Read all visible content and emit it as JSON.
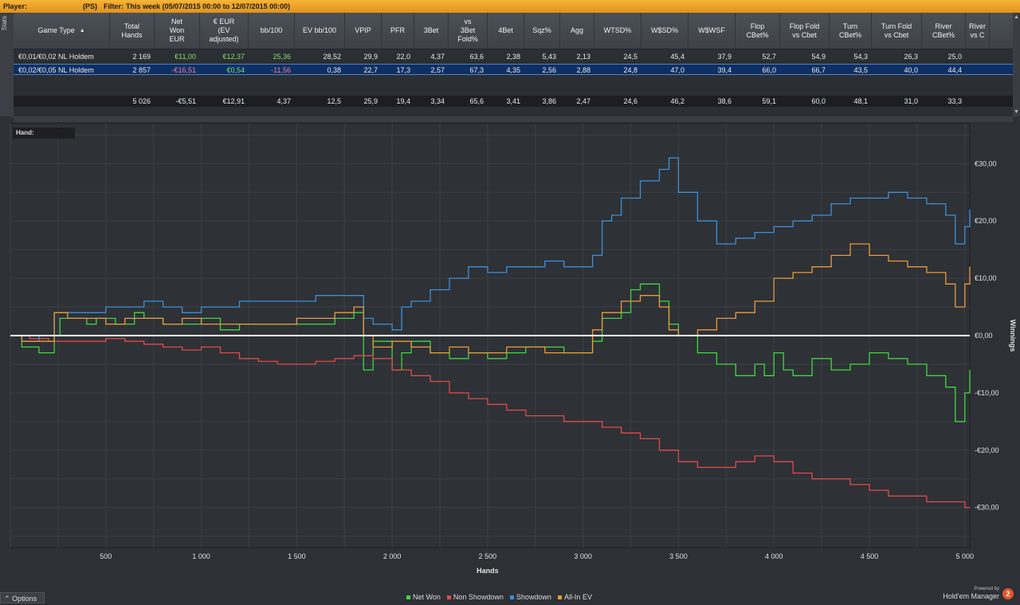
{
  "topbar": {
    "player_label": "Player:",
    "site": "(PS)",
    "filter_label": "Filter:",
    "filter_value": "This week (05/07/2015 00:00 to 12/07/2015 00:00)"
  },
  "stats_tab": "Stats",
  "table": {
    "columns": [
      {
        "label": "Game Type",
        "w": 121
      },
      {
        "label": "Total\nHands",
        "w": 56
      },
      {
        "label": "Net\nWon\nEUR",
        "w": 57
      },
      {
        "label": "€ EUR\n(EV\nadjusted)",
        "w": 61
      },
      {
        "label": "bb/100",
        "w": 58
      },
      {
        "label": "EV bb/100",
        "w": 63
      },
      {
        "label": "VPIP",
        "w": 46
      },
      {
        "label": "PFR",
        "w": 41
      },
      {
        "label": "3Bet",
        "w": 43
      },
      {
        "label": "vs\n3Bet\nFold%",
        "w": 49
      },
      {
        "label": "4Bet",
        "w": 46
      },
      {
        "label": "Sqz%",
        "w": 45
      },
      {
        "label": "Agg",
        "w": 43
      },
      {
        "label": "WTSD%",
        "w": 59
      },
      {
        "label": "W$SD%",
        "w": 59
      },
      {
        "label": "W$WSF",
        "w": 59
      },
      {
        "label": "Flop\nCBet%",
        "w": 56
      },
      {
        "label": "Flop Fold\nvs Cbet",
        "w": 62
      },
      {
        "label": "Turn\nCBet%",
        "w": 53
      },
      {
        "label": "Turn Fold\nvs Cbet",
        "w": 63
      },
      {
        "label": "River\nCBet%",
        "w": 55
      },
      {
        "label": "River\nvs C",
        "w": 30
      }
    ],
    "sort_arrow": "▲",
    "rows": [
      {
        "cells": [
          "€0,01/€0,02 NL Holdem",
          "2 169",
          "€11,00",
          "€12,37",
          "25,36",
          "28,52",
          "29,9",
          "22,0",
          "4,37",
          "63,6",
          "2,38",
          "5,43",
          "2,13",
          "24,5",
          "45,4",
          "37,9",
          "52,7",
          "54,9",
          "54,3",
          "26,3",
          "25,0",
          ""
        ],
        "signs": [
          "",
          "",
          "pos",
          "pos",
          "pos",
          "",
          "",
          "",
          "",
          "",
          "",
          "",
          "",
          "",
          "",
          "",
          "",
          "",
          "",
          "",
          "",
          ""
        ]
      },
      {
        "cells": [
          "€0,02/€0,05 NL Holdem",
          "2 857",
          "-€16,51",
          "€0,54",
          "-11,56",
          "0,38",
          "22,7",
          "17,3",
          "2,57",
          "67,3",
          "4,35",
          "2,56",
          "2,88",
          "24,8",
          "47,0",
          "39,4",
          "66,0",
          "66,7",
          "43,5",
          "40,0",
          "44,4",
          ""
        ],
        "signs": [
          "",
          "",
          "neg",
          "pos",
          "neg",
          "",
          "",
          "",
          "",
          "",
          "",
          "",
          "",
          "",
          "",
          "",
          "",
          "",
          "",
          "",
          "",
          ""
        ]
      }
    ],
    "total": {
      "cells": [
        "",
        "5 026",
        "-€5,51",
        "€12,91",
        "4,37",
        "12,5",
        "25,9",
        "19,4",
        "3,34",
        "65,6",
        "3,41",
        "3,86",
        "2,47",
        "24,6",
        "46,2",
        "38,6",
        "59,1",
        "60,0",
        "48,1",
        "31,0",
        "33,3",
        ""
      ]
    }
  },
  "chart": {
    "hand_label": "Hand:",
    "x_title": "Hands",
    "y_title": "Winnings",
    "x_ticks": [
      "500",
      "1 000",
      "1 500",
      "2 000",
      "2 500",
      "3 000",
      "3 500",
      "4 000",
      "4 500",
      "5 000"
    ],
    "x_tick_values": [
      500,
      1000,
      1500,
      2000,
      2500,
      3000,
      3500,
      4000,
      4500,
      5000
    ],
    "y_ticks": [
      "€30,00",
      "€20,00",
      "€10,00",
      "€0,00",
      "-€10,00",
      "-€20,00",
      "-€30,00"
    ],
    "y_tick_values": [
      30,
      20,
      10,
      0,
      -10,
      -20,
      -30
    ]
  },
  "chart_data": {
    "type": "line",
    "xlabel": "Hands",
    "ylabel": "Winnings",
    "xlim": [
      0,
      5026
    ],
    "ylim": [
      -37,
      37
    ],
    "series": [
      {
        "name": "Net Won",
        "color": "#3fd63f",
        "x": [
          0,
          60,
          150,
          230,
          260,
          300,
          400,
          450,
          550,
          650,
          700,
          800,
          900,
          1000,
          1100,
          1200,
          1300,
          1400,
          1500,
          1600,
          1700,
          1800,
          1850,
          1900,
          2000,
          2050,
          2100,
          2200,
          2300,
          2400,
          2500,
          2600,
          2700,
          2800,
          2900,
          3000,
          3050,
          3100,
          3200,
          3250,
          3300,
          3400,
          3450,
          3500,
          3600,
          3700,
          3800,
          3900,
          3950,
          4000,
          4050,
          4100,
          4200,
          4300,
          4400,
          4500,
          4600,
          4700,
          4800,
          4900,
          4950,
          5000,
          5026
        ],
        "y": [
          0,
          -2,
          -3,
          0,
          3,
          3,
          2,
          3,
          2,
          4,
          3,
          2,
          2,
          3,
          1,
          2,
          2,
          2,
          2,
          2,
          3,
          4,
          -6,
          -1,
          -6,
          -3,
          -1,
          -3,
          -4,
          -3,
          -4,
          -3,
          -2,
          -2,
          -3,
          -3,
          -1,
          3,
          4,
          8,
          9,
          6,
          2,
          0,
          -3,
          -5,
          -7,
          -5,
          -7,
          -3,
          -6,
          -7,
          -4,
          -6,
          -5,
          -3,
          -4,
          -5,
          -7,
          -9,
          -15,
          -10,
          -6
        ]
      },
      {
        "name": "Non Showdown",
        "color": "#e04a4a",
        "x": [
          0,
          100,
          200,
          300,
          400,
          500,
          600,
          700,
          800,
          900,
          1000,
          1100,
          1200,
          1300,
          1400,
          1500,
          1600,
          1700,
          1800,
          1900,
          2000,
          2100,
          2200,
          2300,
          2400,
          2500,
          2600,
          2700,
          2800,
          2900,
          3000,
          3100,
          3200,
          3300,
          3400,
          3500,
          3600,
          3700,
          3800,
          3900,
          4000,
          4100,
          4200,
          4300,
          4400,
          4500,
          4600,
          4700,
          4800,
          4900,
          5000,
          5026
        ],
        "y": [
          0,
          -0.5,
          -1,
          -1,
          -1,
          -0.5,
          -1,
          -1.5,
          -2,
          -2.5,
          -2,
          -3,
          -4,
          -4.5,
          -5,
          -5,
          -4.5,
          -4,
          -3.5,
          -4,
          -6,
          -7,
          -8,
          -10,
          -11,
          -12,
          -13,
          -14,
          -14,
          -15,
          -15,
          -16,
          -17,
          -18,
          -20,
          -22,
          -23,
          -23,
          -22,
          -21,
          -22,
          -24,
          -25,
          -25,
          -26,
          -27,
          -28,
          -28,
          -29,
          -29,
          -30,
          -30
        ]
      },
      {
        "name": "Showdown",
        "color": "#3d8fd6",
        "x": [
          0,
          60,
          150,
          230,
          300,
          400,
          500,
          600,
          700,
          800,
          900,
          1000,
          1100,
          1200,
          1300,
          1400,
          1500,
          1600,
          1700,
          1800,
          1850,
          1900,
          2000,
          2050,
          2100,
          2200,
          2300,
          2400,
          2500,
          2600,
          2700,
          2800,
          2900,
          3000,
          3050,
          3100,
          3150,
          3200,
          3300,
          3400,
          3450,
          3500,
          3600,
          3700,
          3800,
          3900,
          4000,
          4100,
          4200,
          4300,
          4400,
          4500,
          4600,
          4700,
          4800,
          4900,
          4950,
          5000,
          5026
        ],
        "y": [
          0,
          -1,
          0,
          4,
          4,
          4,
          5,
          5,
          6,
          5,
          4,
          5,
          5,
          6,
          6,
          6,
          6,
          7,
          7,
          7,
          3,
          2,
          1,
          5,
          6,
          8,
          10,
          12,
          11,
          12,
          12,
          13,
          12,
          12,
          14,
          20,
          21,
          24,
          27,
          29,
          31,
          25,
          20,
          16,
          17,
          18,
          19,
          20,
          21,
          23,
          24,
          24,
          25,
          24,
          23,
          21,
          16,
          19,
          22
        ]
      },
      {
        "name": "All-In EV",
        "color": "#e89a3c",
        "x": [
          0,
          60,
          150,
          230,
          300,
          400,
          500,
          600,
          700,
          800,
          900,
          1000,
          1100,
          1200,
          1300,
          1400,
          1500,
          1600,
          1700,
          1800,
          1850,
          1900,
          2000,
          2100,
          2200,
          2300,
          2400,
          2500,
          2600,
          2700,
          2800,
          2900,
          3000,
          3050,
          3100,
          3200,
          3300,
          3400,
          3450,
          3500,
          3600,
          3700,
          3800,
          3900,
          4000,
          4100,
          4200,
          4300,
          4400,
          4500,
          4600,
          4700,
          4800,
          4900,
          4950,
          5000,
          5026
        ],
        "y": [
          0,
          -1,
          -1,
          4,
          3,
          3,
          2,
          3,
          3,
          2,
          3,
          2,
          2,
          2,
          2,
          2,
          3,
          3,
          4,
          5,
          0,
          -2,
          -1,
          -2,
          -3,
          -2,
          -3,
          -3,
          -2,
          -2,
          -3,
          -3,
          -3,
          1,
          4,
          6,
          7,
          5,
          1,
          0,
          1,
          3,
          4,
          6,
          10,
          11,
          12,
          14,
          16,
          14,
          13,
          12,
          11,
          9,
          5,
          9,
          12
        ]
      }
    ]
  },
  "bottom": {
    "options": "Options",
    "legend": [
      {
        "label": "Net Won",
        "color": "#3fd63f"
      },
      {
        "label": "Non Showdown",
        "color": "#e04a4a"
      },
      {
        "label": "Showdown",
        "color": "#3d8fd6"
      },
      {
        "label": "All-In EV",
        "color": "#e89a3c"
      }
    ],
    "brand_powered": "Powered by",
    "brand_name": "Hold'em Manager",
    "brand_badge": "2"
  }
}
